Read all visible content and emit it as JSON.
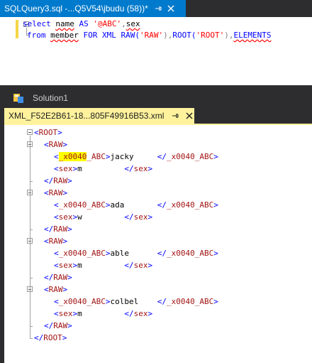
{
  "sql_tab": {
    "title": "SQLQuery3.sql -...Q5V54\\jbudu (58))*",
    "pin_glyph": "⊣",
    "close_glyph": "✕"
  },
  "sql": {
    "line1": {
      "kw_select": "select",
      "sp1": " ",
      "col_name": "name",
      "sp2": " ",
      "kw_as": "AS",
      "sp3": " ",
      "alias": "'@ABC'",
      "comma": ",",
      "col_sex": "sex"
    },
    "line2": {
      "kw_from": "from",
      "sp1": " ",
      "table": "member",
      "sp2": " ",
      "kw_for": "FOR XML RAW(",
      "raw_arg": "'RAW'",
      "close1": ")",
      "comma": ",",
      "kw_root": "ROOT(",
      "root_arg": "'ROOT'",
      "close2": ")",
      "comma2": ",",
      "kw_elements": "ELEMENTS"
    }
  },
  "solution": {
    "label": "Solution1"
  },
  "xml_tab": {
    "title": "XML_F52E2B61-18...805F49916B53.xml",
    "pin_glyph": "⊣",
    "close_glyph": "✕"
  },
  "xml": {
    "root_tag": "ROOT",
    "raw_tag": "RAW",
    "name_tag_prefix": "_x0040",
    "name_tag_suffix": "_ABC",
    "sex_tag": "sex",
    "rows": [
      {
        "name": "jacky     ",
        "sex": "m         "
      },
      {
        "name": "ada       ",
        "sex": "w         "
      },
      {
        "name": "able      ",
        "sex": "m         "
      },
      {
        "name": "colbel    ",
        "sex": "m         "
      }
    ]
  },
  "colors": {
    "accent": "#007acc",
    "xml_tab": "#fff29d",
    "highlight": "#ffff00",
    "tag": "#a31515",
    "bracket": "#0000ff"
  }
}
